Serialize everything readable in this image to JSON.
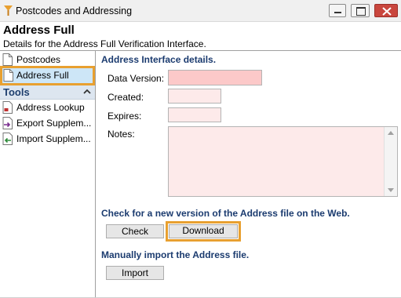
{
  "window": {
    "title": "Postcodes and Addressing",
    "controls": [
      "minimize",
      "maximize",
      "close"
    ]
  },
  "header": {
    "title": "Address Full",
    "subtitle": "Details for the Address Full Verification Interface."
  },
  "nav": {
    "items": [
      {
        "label": "Postcodes",
        "icon": "document-icon",
        "selected": false
      },
      {
        "label": "Address Full",
        "icon": "document-icon",
        "selected": true
      }
    ],
    "tools_header": "Tools",
    "tools": [
      {
        "label": "Address Lookup",
        "icon": "address-lookup-icon"
      },
      {
        "label": "Export Supplem...",
        "icon": "export-icon"
      },
      {
        "label": "Import Supplem...",
        "icon": "import-icon"
      }
    ]
  },
  "main": {
    "details_title": "Address Interface details.",
    "fields": {
      "data_version": {
        "label": "Data Version:",
        "value": ""
      },
      "created": {
        "label": "Created:",
        "value": ""
      },
      "expires": {
        "label": "Expires:",
        "value": ""
      },
      "notes": {
        "label": "Notes:",
        "value": ""
      }
    },
    "web_check_title": "Check for a new version of the Address file on the Web.",
    "check_button": "Check",
    "download_button": "Download",
    "manual_import_title": "Manually import the Address file.",
    "import_button": "Import"
  },
  "colors": {
    "highlight_border": "#e8a030",
    "selected_bg": "#cde6f7",
    "section_title": "#1b3b6f",
    "required_field": "#fcc9c9",
    "field_bg": "#fdeaea",
    "close_button": "#c9463d"
  }
}
